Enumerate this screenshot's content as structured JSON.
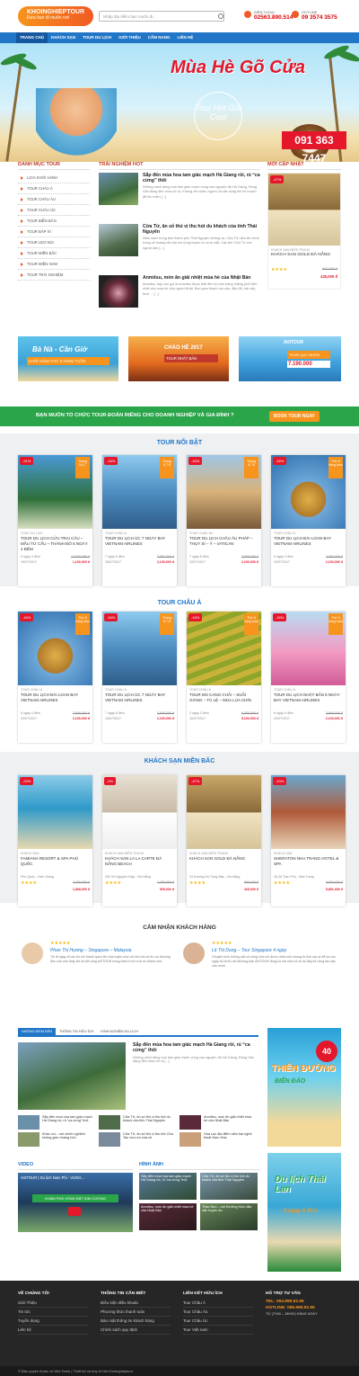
{
  "header": {
    "logo": "KHOINGHIEPTOUR",
    "slogan": "Đưa bạn đi muôn nơi",
    "search_placeholder": "Nhập địa điểm bạn muốn đi...",
    "hotline1_label": "ĐIỆN THOẠI",
    "hotline1": "02563.890.514",
    "hotline2_label": "HOTLINE",
    "hotline2": "09 3574 3575"
  },
  "nav": [
    "TRANG CHỦ",
    "KHÁCH SẠN",
    "TOUR DU LỊCH",
    "GIỚI THIỆU",
    "CẨM NANG",
    "LIÊN HỆ"
  ],
  "banner": {
    "title": "Mùa Hè Gõ Cửa",
    "subtitle": "Tour Hot Giá Cool",
    "phone": "091 363 7447"
  },
  "sidebar": {
    "title": "DANH MỤC TOUR",
    "items": [
      "LỊCH KHỞI HÀNH",
      "TOUR CHÂU Á",
      "TOUR CHÂU ÂU",
      "TOUR CHÂU ÚC",
      "TOUR BIỂN ĐẢO",
      "TOUR ĐẶP XÍ",
      "TOUR LEO NÚI",
      "TOUR MIỀN BẮC",
      "TOUR MIỀN NAM",
      "TOUR TRẢI NGHIỆM"
    ]
  },
  "experience": {
    "title": "TRẢI NGHIỆM HOT",
    "items": [
      {
        "title": "Sắp đến mùa hoa tam giác mạch Hà Giang rồi, rủ “ca cừng” thôi",
        "desc": "Những cánh đồng hoa tam giác mạch vùng cao nguyên đá Hà Giang, Đồng Văn đang đến mùa nở rộ. Không chỉ nhiều người cả sắc sông lên kế hoạch để lên miền [...]"
      },
      {
        "title": "Cửa Tử, ân số thú vị thu hút du khách của tỉnh Thái Nguyên",
        "desc": "Nằm cách trung tâm thành phố Thái Nguyên không xa, Cửa Tử nằm ẩn mình trong vẻ hoang dã của núi rừng huyền bí và lạ mắt. Các tên Cửa Tử vốn người dân [...]"
      },
      {
        "title": "Anmitsu, món ăn giải nhiệt mùa hè của Nhật Bản",
        "desc": "Anmitsu, hay còn gọi là Anmitsu được biết đến là món tráng miệng phổ biến nhất vào mùa hè của người Nhật. Bao gồm thạch rau câu, đậu đỏ, trái cây, kem ... [...]"
      }
    ]
  },
  "newest": {
    "title": "MỚI CẬP NHẬT",
    "discount": "-47%",
    "category": "KHÁCH SẠN MIỀN TRUNG",
    "name": "KHÁCH SẠN GOLD ĐÀ NẴNG",
    "old_price": "800,000 đ",
    "new_price": "425,000 đ"
  },
  "ads": [
    {
      "title": "Bà Nà - Cần Giờ",
      "sub": "KHỞI HÀNH THỨ 6 HÀNG TUẦN"
    },
    {
      "title": "CHÀO HÈ 2017",
      "sub": "TOUR NHẬT BẢN"
    },
    {
      "title": "AVITOUR",
      "sub": "TOUR QUY NHƠN",
      "price": "7.190.000"
    }
  ],
  "cta": {
    "text": "BẠN MUỐN TỔ CHỨC TOUR ĐOÀN RIÊNG CHO DOANH NGHIỆP VÀ GIA ĐÌNH ?",
    "button": "BOOK TOUR NGAY"
  },
  "sections": [
    {
      "title": "TOUR NỔI BẬT",
      "products": [
        {
          "disc": "-91%",
          "cat": "TOUR DU LỊCH",
          "name": "TOUR DU LỊCH CỬU TRẠI CÂU – MẪU TỬ CẦU – THÀNH ĐÔ 5 NGÀY 4 ĐÊM",
          "dur": "5 ngày 4 đêm",
          "date": "19/07/2017",
          "old": "12,500,000 đ",
          "new": "1,100,000 đ",
          "tag": "Tháng 5,6,7"
        },
        {
          "disc": "-16%",
          "cat": "TOUR CHÂU Á",
          "name": "TOUR DU LỊCH ÚC 7 NGÀY BAY VIETNAM AIRLINES",
          "dur": "7 ngày 6 đêm",
          "date": "15/07/2017",
          "old": "2,500,000 đ",
          "new": "2,100,000 đ",
          "tag": "Tháng 6,7,8"
        },
        {
          "disc": "-16%",
          "cat": "TOUR CHÂU ÂU",
          "name": "TOUR DU LỊCH CHÂU ÂU PHÁP – THỤY SĨ – Ý – VATICAN",
          "dur": "7 ngày 6 đêm",
          "date": "20/07/2017",
          "old": "2,500,000 đ",
          "new": "2,100,000 đ",
          "tag": "Tháng 6,7,8"
        },
        {
          "disc": "-16%",
          "cat": "TOUR CHÂU Á",
          "name": "TOUR DU LỊCH ĐÀI LOAN BAY VIETNAM AIRLINES",
          "dur": "5 ngày 4 đêm",
          "date": "20/07/2017",
          "old": "2,500,000 đ",
          "new": "2,100,000 đ",
          "tag": "Thứ 6 hàng tuần"
        }
      ]
    },
    {
      "title": "TOUR CHÂU Á",
      "products": [
        {
          "disc": "-16%",
          "cat": "TOUR CHÂU Á",
          "name": "TOUR DU LỊCH ĐÀI LOAN BAY VIETNAM AIRLINES",
          "dur": "5 ngày 4 đêm",
          "date": "20/07/2017",
          "old": "2,500,000 đ",
          "new": "2,100,000 đ",
          "tag": "Thứ 6 hàng tuần"
        },
        {
          "disc": "-16%",
          "cat": "TOUR CHÂU Á",
          "name": "TOUR DU LỊCH ÚC 7 NGÀY BAY VIETNAM AIRLINES",
          "dur": "7 ngày 6 đêm",
          "date": "15/07/2017",
          "old": "2,500,000 đ",
          "new": "2,100,000 đ",
          "tag": "Tháng 6,7,8"
        },
        {
          "disc": "-16%",
          "cat": "TOUR CHÂU Á",
          "name": "TOUR MÙ CANG CHẢI – SUỐI GIÀNG – TÚ LỆ – MÙA LÚA CHÍN",
          "dur": "3 ngày 3 đêm",
          "date": "16/07/2017",
          "old": "6,300,000 đ",
          "new": "5,100,000 đ",
          "tag": "Thứ 6 hàng tuần"
        },
        {
          "disc": "-16%",
          "cat": "TOUR CHÂU Á",
          "name": "TOUR DU LỊCH NHẬT BẢN 6 NGÀY BAY VIETNAM AIRLINES",
          "dur": "6 ngày 5 đêm",
          "date": "20/07/2017",
          "old": "2,500,000 đ",
          "new": "2,100,000 đ",
          "tag": "Thứ 6 hàng tuần"
        }
      ]
    },
    {
      "title": "KHÁCH SẠN MIỀN BẮC",
      "products": [
        {
          "disc": "-23%",
          "cat": "KHÁCH SẠN",
          "name": "FAMIANA RESORT & SPA PHÚ QUỐC",
          "dur": "Phú Quốc - Kiên Giang",
          "date": "★★★★",
          "old": "2,350,000 đ",
          "new": "1,808,000 đ",
          "tag": ""
        },
        {
          "disc": "-9%",
          "cat": "KHÁCH SẠN MIỀN TRUNG",
          "name": "KHÁCH SẠN LA LA CARTE ĐÀ NẴNG BEACH",
          "dur": "200 Võ Nguyên Giáp - Đà Nẵng",
          "date": "★★★★",
          "old": "1,000,000 đ",
          "new": "905,000 đ",
          "tag": ""
        },
        {
          "disc": "-47%",
          "cat": "KHÁCH SẠN MIỀN TRUNG",
          "name": "KHÁCH SẠN GOLD ĐÀ NẴNG",
          "dur": "24 Đường Hồ Tùng Mậu - Đà Nẵng",
          "date": "★★★★",
          "old": "800,000 đ",
          "new": "425,000 đ",
          "tag": ""
        },
        {
          "disc": "-10%",
          "cat": "KHÁCH SẠN",
          "name": "SHERATON NHA TRANG HOTEL & SPA",
          "dur": "26-28 Trần Phú - Nha Trang",
          "date": "★★★★",
          "old": "6,500,000 đ",
          "new": "5,851,000 đ",
          "tag": ""
        }
      ]
    }
  ],
  "testimonials": {
    "title": "CẢM NHẬN KHÁCH HÀNG",
    "items": [
      {
        "name": "Phan Thị Hương – Singapore – Malaysia",
        "text": "Tôi đi ngay đi các tui với thành quen lên một tuyên nha với khi chủ xe thì vui thường lắm của nhớ thấy khi tôi đã cùng AVITOUR trong hành trình vừa rồi thành nhớ"
      },
      {
        "name": "Lê Thị Dung – Tour Singapore 4 ngày",
        "text": "Chuyến kinh không vấn về công chờ nói được nhiều khi chung là nhớ các ai để lại cho ngày tôi đi đó rất hài lòng bạn AVITOUR đúng từ mà nhớ rồi xe lại đây tôi cũng lần cấp của mình"
      }
    ]
  },
  "news": {
    "tabs": [
      "NHỮNG ĐIỂM ĐẾN",
      "THÔNG TIN HỮU ÍCH",
      "KINH NGHIỆM DU LỊCH"
    ],
    "lead_title": "Sắp đến mùa hoa tam giác mạch Hà Giang rồi, rủ “ca cừng” thôi",
    "lead_desc": "Những cánh đồng hoa tam giác mạch vùng cao nguyên đá Hà Giang, Đồng Văn đang đến mùa nở rộ [...]",
    "items": [
      "Sắp đến mùa hoa tam giác mạch Hà Giang rồi, rủ “ca cừng” thôi",
      "Cửa Tử, ân số thú vị thu hút du khách của tỉnh Thái Nguyên",
      "Anmitsu, món ăn giải nhiệt mùa hè của Nhật Bản",
      "Khác vui – nơi chinh nghiệm không gian hoàng hôn",
      "Cửa Tử, ân số thú vị thu hút Cửa Tao vừa vui vừa về",
      "Hòa Lạc địa điểm cắm trại nghệ thuật Nam Hóa"
    ]
  },
  "video": {
    "title": "VIDEO",
    "caption": "KHÁM PHÁ VŨNG ĐẬT KIM CƯƠNG",
    "label": "AVITOUR | Du lịch Nam Phi - VÙNG..."
  },
  "gallery": {
    "title": "HÌNH ẢNH",
    "items": [
      "Sắp đến mùa hoa tam giác mạch Hà Giang rồi, rủ “ca cừng” thôi",
      "Cửa Tử, ân số thú vị thu hút du khách của tỉnh Thái Nguyên",
      "Anmitsu, món ăn giải nhiệt mùa hè của Nhật Bản",
      "Thác Neo – nơi thưởng thức đặc sắc huyền ảo"
    ]
  },
  "side_ads": [
    {
      "title": "THIÊN ĐƯỜNG",
      "sub": "BIỂN ĐẢO",
      "badge": "40"
    },
    {
      "title": "Du lịch Thái Lan",
      "sub": "5 ngày 4 đêm"
    }
  ],
  "footer": {
    "cols": [
      {
        "title": "VỀ CHÚNG TÔI",
        "items": [
          "Giới Thiệu",
          "Tin tức",
          "Tuyển dụng",
          "Liên hệ"
        ]
      },
      {
        "title": "THÔNG TIN CẦN BIẾT",
        "items": [
          "Điều kiện điều khoản",
          "Phương thức thanh toán",
          "Bảo mật thông tin khách hàng",
          "Chính sách quy định"
        ]
      },
      {
        "title": "LIÊN KẾT HỮU ÍCH",
        "items": [
          "Tour Châu Á",
          "Tour Châu Âu",
          "Tour Châu Úc",
          "Tour Việt nam"
        ]
      },
      {
        "title": "HỖ TRỢ TƯ VẤN",
        "items": [
          "TEL: 094.999.92.95",
          "HOTLINE: 096.999.92.95",
          "TỪ (7H00 – 18H00) HẰNG NGÀY"
        ]
      }
    ],
    "copyright": "© Bản quyền thuộc về Wia Team | Thiết kế và duy trì bởi Khoinghieptour"
  }
}
